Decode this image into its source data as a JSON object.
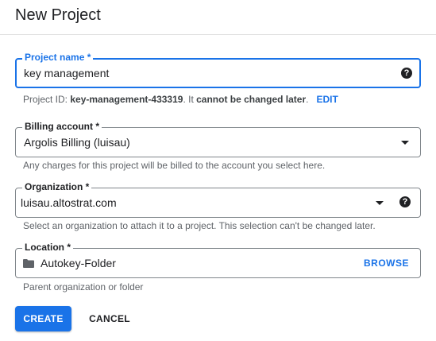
{
  "dialog": {
    "title": "New Project"
  },
  "project_name": {
    "label": "Project name *",
    "value": "key management",
    "help_icon": "help-circle-icon",
    "hint_prefix": "Project ID: ",
    "project_id": "key-management-433319",
    "hint_middle": ". It ",
    "hint_bold": "cannot be changed later",
    "hint_suffix": ".",
    "edit_label": "EDIT"
  },
  "billing": {
    "label": "Billing account *",
    "value": "Argolis Billing (luisau)",
    "hint": "Any charges for this project will be billed to the account you select here."
  },
  "organization": {
    "label": "Organization *",
    "value": "luisau.altostrat.com",
    "hint": "Select an organization to attach it to a project. This selection can't be changed later."
  },
  "location": {
    "label": "Location *",
    "value": "Autokey-Folder",
    "browse_label": "BROWSE",
    "hint": "Parent organization or folder"
  },
  "actions": {
    "create": "CREATE",
    "cancel": "CANCEL"
  },
  "colors": {
    "accent": "#1a73e8",
    "border": "#80868b",
    "hint": "#5f6368"
  }
}
